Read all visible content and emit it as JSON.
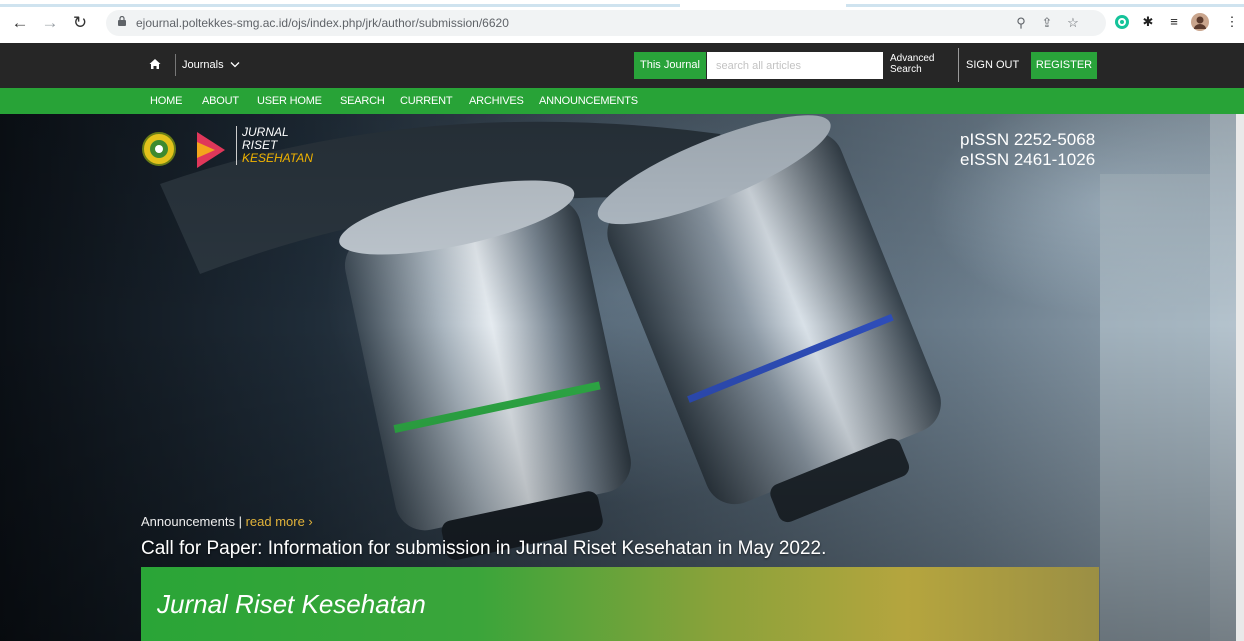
{
  "browser": {
    "url": "ejournal.poltekkes-smg.ac.id/ojs/index.php/jrk/author/submission/6620"
  },
  "site_header": {
    "journals_label": "Journals",
    "scope_label": "This Journal",
    "search_placeholder": "search all articles",
    "advanced_line1": "Advanced",
    "advanced_line2": "Search",
    "signout_label": "SIGN OUT",
    "register_label": "REGISTER"
  },
  "nav": {
    "items": [
      {
        "label": "HOME"
      },
      {
        "label": "ABOUT"
      },
      {
        "label": "USER HOME"
      },
      {
        "label": "SEARCH"
      },
      {
        "label": "CURRENT"
      },
      {
        "label": "ARCHIVES"
      },
      {
        "label": "ANNOUNCEMENTS"
      }
    ]
  },
  "logo": {
    "line1": "JURNAL",
    "line2": "RISET",
    "line3": "KESEHATAN"
  },
  "issn": {
    "print": "pISSN 2252-5068",
    "electronic": "eISSN 2461-1026"
  },
  "announcement": {
    "label": "Announcements",
    "separator": " | ",
    "read_more": "read more",
    "read_more_arrow": " ›",
    "headline": "Call for Paper: Information for submission in Jurnal Riset Kesehatan in May 2022."
  },
  "banner": {
    "title": "Jurnal Riset Kesehatan"
  },
  "colors": {
    "green": "#28a337",
    "dark_bar": "#262626",
    "accent_yellow": "#f2b400"
  }
}
